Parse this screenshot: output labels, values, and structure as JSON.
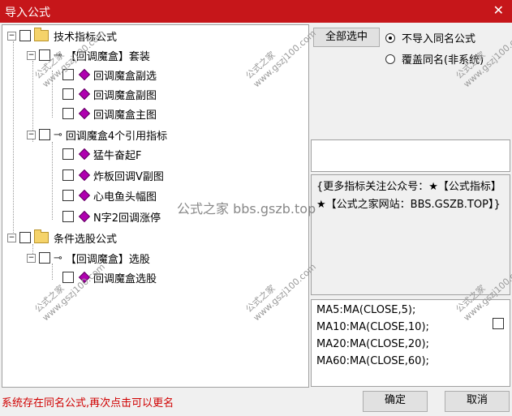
{
  "window": {
    "title": "导入公式",
    "close_glyph": "✕"
  },
  "tree": {
    "groups": [
      {
        "label": "技术指标公式"
      },
      {
        "label": "【回调魔盒】套装"
      },
      {
        "label": "回调魔盒副选"
      },
      {
        "label": "回调魔盒副图"
      },
      {
        "label": "回调魔盒主图"
      },
      {
        "label": "回调魔盒4个引用指标"
      },
      {
        "label": "猛牛奋起F"
      },
      {
        "label": "炸板回调V副图"
      },
      {
        "label": "心电鱼头幅图"
      },
      {
        "label": "N字2回调涨停"
      },
      {
        "label": "条件选股公式"
      },
      {
        "label": "【回调魔盒】选股"
      },
      {
        "label": "回调魔盒选股"
      }
    ]
  },
  "right": {
    "select_all_label": "全部选中",
    "radio_no_import": "不导入同名公式",
    "radio_overwrite": "覆盖同名(非系统)"
  },
  "info": {
    "text": "{更多指标关注公众号：★【公式指标】★【公式之家网站：BBS.GSZB.TOP】}"
  },
  "formula": {
    "lines": [
      "MA5:MA(CLOSE,5);",
      "MA10:MA(CLOSE,10);",
      "MA20:MA(CLOSE,20);",
      "MA60:MA(CLOSE,60);"
    ]
  },
  "footer": {
    "status": "系统存在同名公式,再次点击可以更名",
    "ok_label": "确定",
    "cancel_label": "取消"
  },
  "watermarks": {
    "small_top": "公式之家",
    "small_bottom": "www.gszj100.com",
    "big": "公式之家 bbs.gszb.top"
  }
}
